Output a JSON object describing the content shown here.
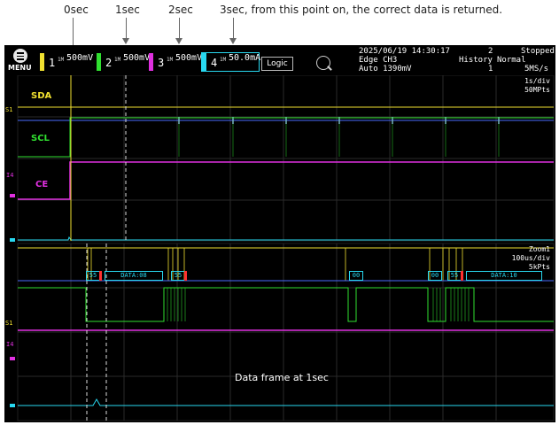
{
  "annotations": {
    "t0": "0sec",
    "t1": "1sec",
    "t2": "2sec",
    "t3": "3sec, from this point on, the correct data is returned."
  },
  "menu": {
    "label": "MENU"
  },
  "channels": [
    {
      "num": "1",
      "coupling": "1M",
      "scale": "500mV",
      "color": "#f0e030"
    },
    {
      "num": "2",
      "coupling": "1M",
      "scale": "500mV",
      "color": "#30e030"
    },
    {
      "num": "3",
      "coupling": "1M",
      "scale": "500mV",
      "color": "#e030e0"
    },
    {
      "num": "4",
      "coupling": "1M",
      "scale": "50.0mA",
      "color": "#28d8f0"
    }
  ],
  "logic": {
    "label": "Logic"
  },
  "timestamp": "2025/06/19 14:30:17",
  "trigger": {
    "mode": "Edge CH3",
    "auto": "Auto 1390mV"
  },
  "acq": {
    "count": "2",
    "state": "Stopped",
    "history_label": "History",
    "history_value": "1",
    "normal": "Normal",
    "rate": "5MS/s"
  },
  "main_scale": {
    "div": "1s/div",
    "pts": "50MPts"
  },
  "zoom_scale": {
    "name": "Zoom1",
    "div": "100us/div",
    "pts": "5kPts"
  },
  "signals": {
    "sda": "SDA",
    "scl": "SCL",
    "ce": "CE"
  },
  "ch_markers": {
    "s1": "S1",
    "s1b": "S1",
    "i4": "I4",
    "i4b": "I4"
  },
  "decode": {
    "b1": "55",
    "b2": "DATA:08",
    "b3": "55",
    "b4": "00",
    "b5": "00",
    "b6": "55",
    "b7": "DATA:10"
  },
  "frame_label": "Data frame at 1sec"
}
